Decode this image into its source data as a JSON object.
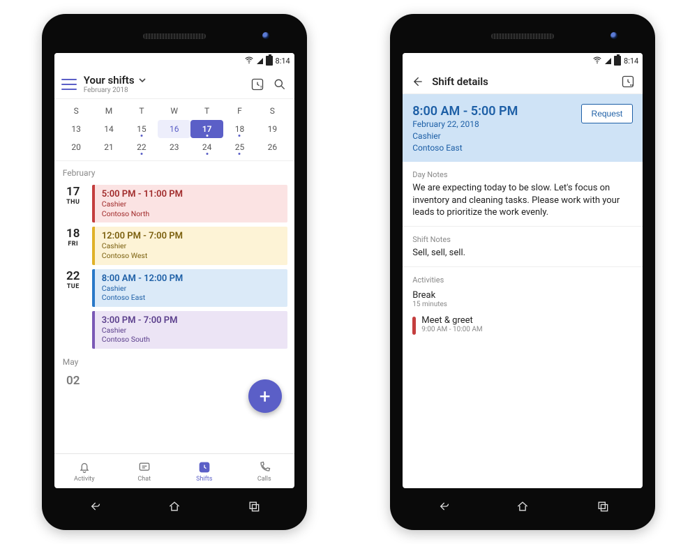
{
  "status": {
    "time": "8:14"
  },
  "left": {
    "header": {
      "title": "Your shifts",
      "subtitle": "February 2018"
    },
    "calendar": {
      "dow": [
        "S",
        "M",
        "T",
        "W",
        "T",
        "F",
        "S"
      ],
      "week1": [
        "13",
        "14",
        "15",
        "16",
        "17",
        "18",
        "19"
      ],
      "week2": [
        "20",
        "21",
        "22",
        "23",
        "24",
        "25",
        "26"
      ]
    },
    "list": {
      "month1": "February",
      "d1": {
        "num": "17",
        "dow": "THU",
        "card": {
          "time": "5:00 PM - 11:00 PM",
          "role": "Cashier",
          "loc": "Contoso North"
        }
      },
      "d2": {
        "num": "18",
        "dow": "FRI",
        "card": {
          "time": "12:00 PM - 7:00 PM",
          "role": "Cashier",
          "loc": "Contoso West"
        }
      },
      "d3": {
        "num": "22",
        "dow": "TUE",
        "card1": {
          "time": "8:00 AM - 12:00 PM",
          "role": "Cashier",
          "loc": "Contoso East"
        },
        "card2": {
          "time": "3:00 PM - 7:00 PM",
          "role": "Cashier",
          "loc": "Contoso South"
        }
      },
      "month2": "May",
      "d4": {
        "num": "02"
      }
    },
    "tabs": {
      "activity": "Activity",
      "chat": "Chat",
      "shifts": "Shifts",
      "calls": "Calls"
    }
  },
  "right": {
    "header": {
      "title": "Shift details"
    },
    "detail": {
      "time": "8:00 AM - 5:00 PM",
      "date": "February 22, 2018",
      "role": "Cashier",
      "loc": "Contoso East",
      "request": "Request"
    },
    "dayNotesLabel": "Day Notes",
    "dayNotes": "We are expecting today to be slow. Let's focus on inventory and cleaning tasks. Please work with your leads to prioritize the work evenly.",
    "shiftNotesLabel": "Shift Notes",
    "shiftNotes": "Sell, sell, sell.",
    "activitiesLabel": "Activities",
    "act1": {
      "title": "Break",
      "sub": "15 minutes"
    },
    "act2": {
      "title": "Meet & greet",
      "sub": "9:00 AM - 10:00 AM"
    }
  }
}
